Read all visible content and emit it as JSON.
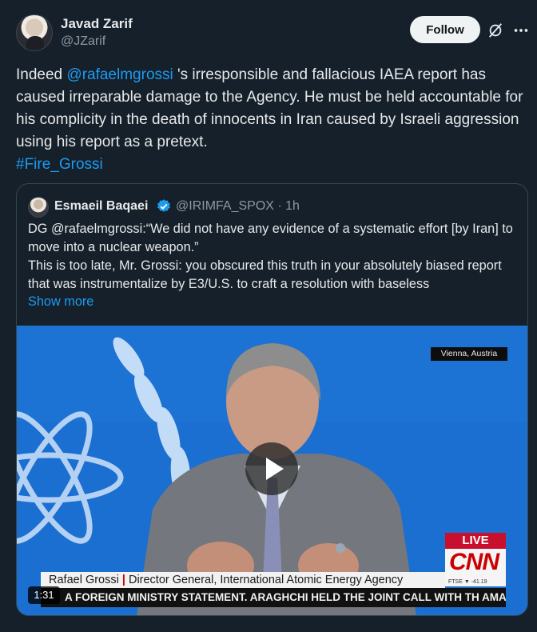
{
  "author": {
    "name": "Javad Zarif",
    "handle": "@JZarif"
  },
  "actions": {
    "follow_label": "Follow"
  },
  "post": {
    "text_1": "Indeed ",
    "mention": "@rafaelmgrossi",
    "text_2": " 's irresponsible and fallacious IAEA report has caused irreparable damage to the Agency. He must be held accountable for his complicity in the death of innocents in Iran caused by Israeli aggression using his report as a pretext.",
    "hashtag": "#Fire_Grossi"
  },
  "quoted": {
    "name": "Esmaeil Baqaei",
    "handle_time": "@IRIMFA_SPOX · 1h",
    "line_1": "DG @rafaelmgrossi:“We did not have any evidence of a systematic effort [by Iran] to move into a nuclear weapon.”",
    "line_2": "This is too late, Mr. Grossi: you obscured this truth in your absolutely biased report that was instrumentalize by E3/U.S. to craft a resolution with baseless",
    "show_more": "Show more"
  },
  "video": {
    "dateline": "Vienna, Austria",
    "live": "LIVE",
    "network": "CNN",
    "ticker": "FTSE ▼ -41.19",
    "name_strap": "Rafael Grossi",
    "strap_sep": "|",
    "title_strap": "Director General, International Atomic Energy Agency",
    "crawl": "A FOREIGN MINISTRY STATEMENT. ARAGHCHI HELD THE JOINT CALL WITH TH AMANPOUR",
    "duration": "1:31"
  },
  "colors": {
    "background": "#15202b",
    "link": "#1d9bf0",
    "video_bg": "#1a6fd1",
    "cnn_red": "#cc0000"
  }
}
